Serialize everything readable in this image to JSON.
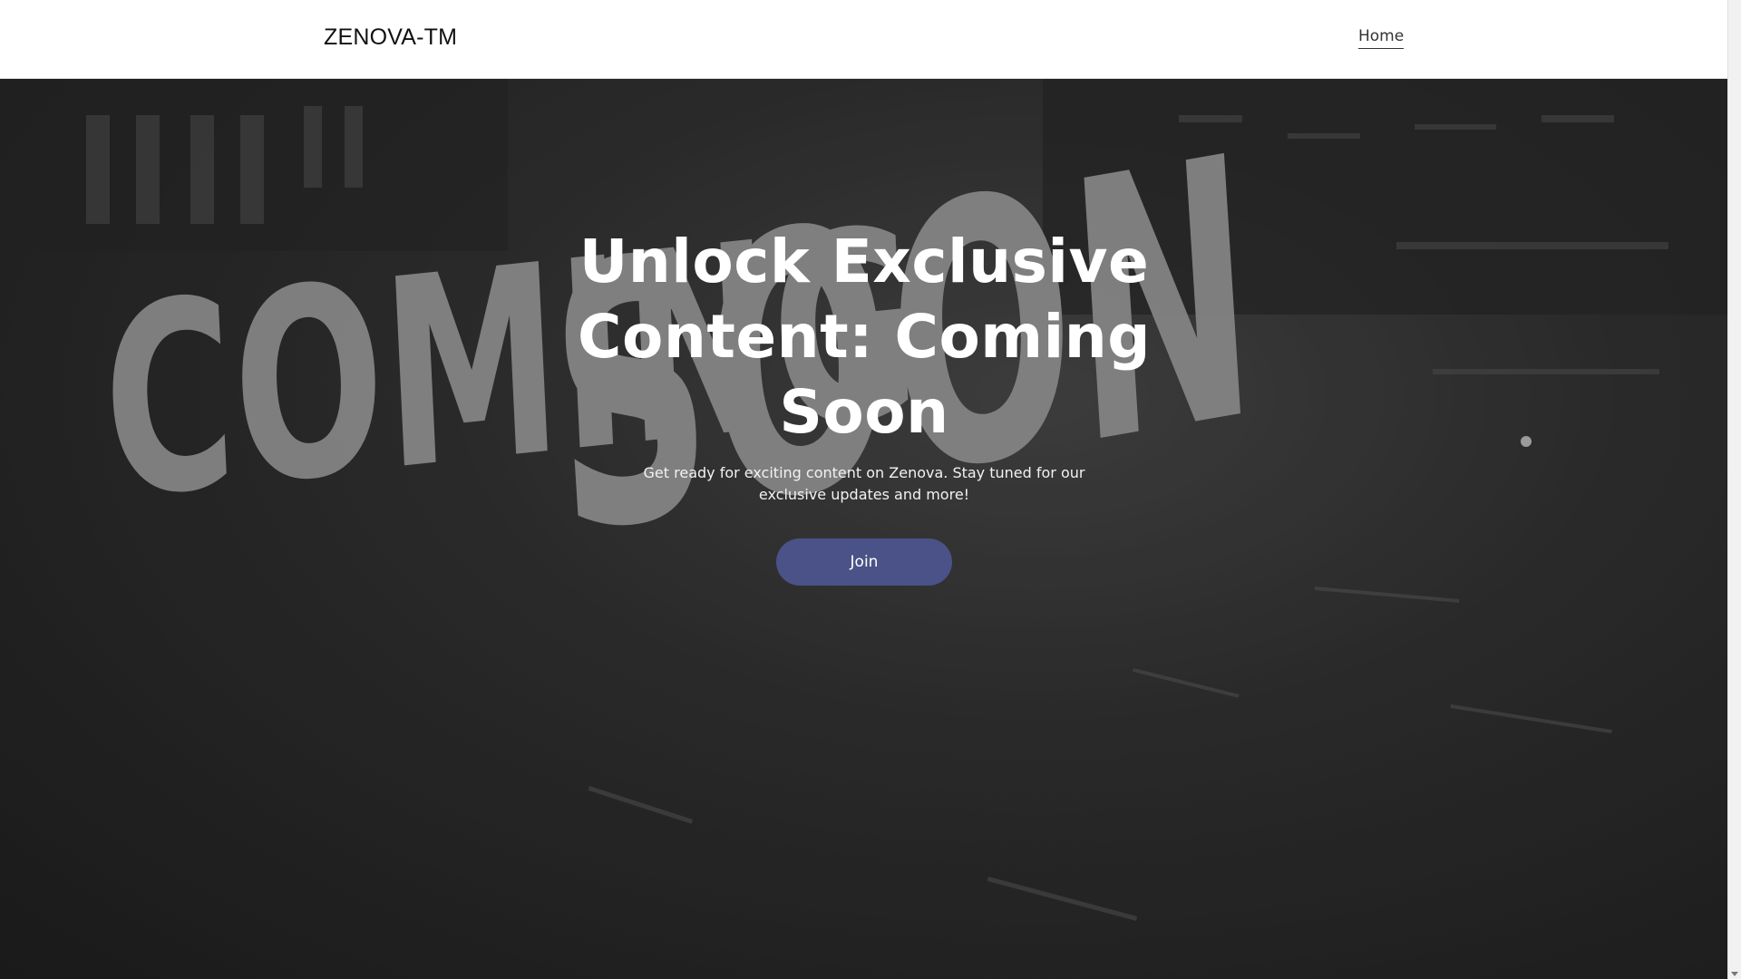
{
  "header": {
    "brand": "ZENOVA-TM",
    "nav": [
      {
        "label": "Home"
      }
    ]
  },
  "hero": {
    "background_text": [
      "COMING",
      "SOON"
    ],
    "title_lines": [
      "Unlock Exclusive",
      "Content: Coming",
      "Soon"
    ],
    "subtitle_lines": [
      "Get ready for exciting content on Zenova. Stay tuned for our",
      "exclusive updates and more!"
    ],
    "button_label": "Join"
  },
  "colors": {
    "accent": "#4a5287",
    "header_bg": "#ffffff",
    "hero_text": "#ffffff"
  }
}
